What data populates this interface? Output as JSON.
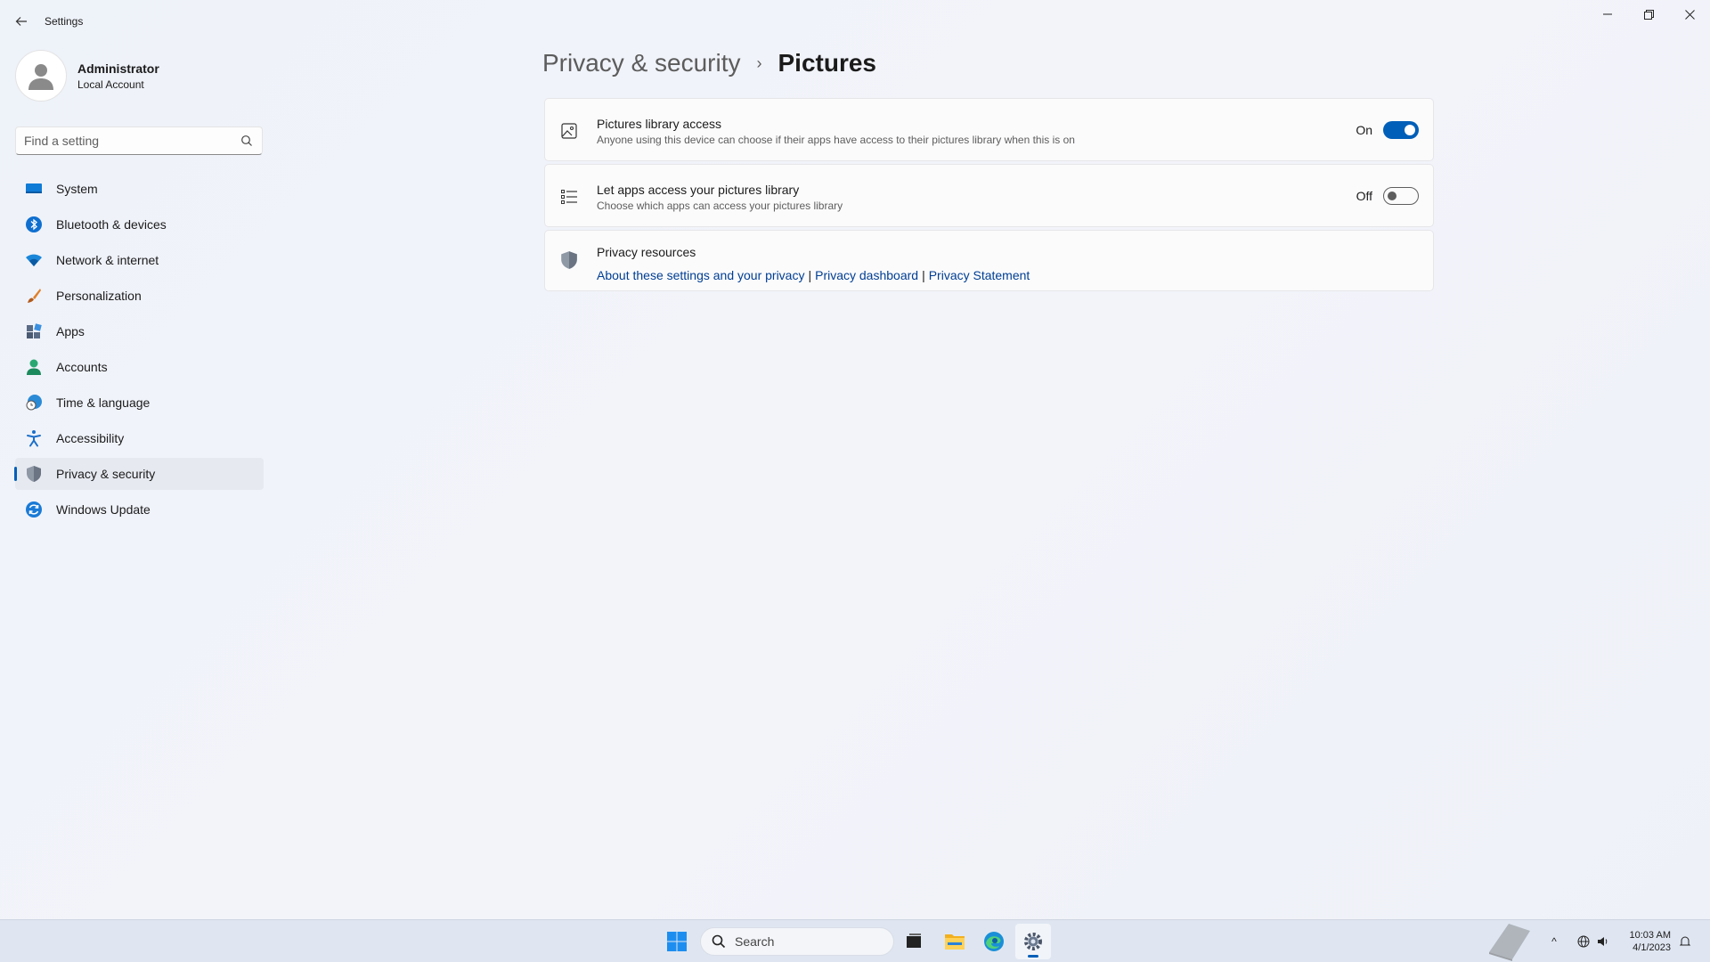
{
  "window": {
    "title": "Settings"
  },
  "profile": {
    "name": "Administrator",
    "account_type": "Local Account"
  },
  "search": {
    "placeholder": "Find a setting"
  },
  "sidebar": {
    "items": [
      {
        "label": "System",
        "icon": "system-icon",
        "active": false
      },
      {
        "label": "Bluetooth & devices",
        "icon": "bluetooth-icon",
        "active": false
      },
      {
        "label": "Network & internet",
        "icon": "wifi-icon",
        "active": false
      },
      {
        "label": "Personalization",
        "icon": "brush-icon",
        "active": false
      },
      {
        "label": "Apps",
        "icon": "apps-icon",
        "active": false
      },
      {
        "label": "Accounts",
        "icon": "person-icon",
        "active": false
      },
      {
        "label": "Time & language",
        "icon": "globe-clock-icon",
        "active": false
      },
      {
        "label": "Accessibility",
        "icon": "accessibility-icon",
        "active": false
      },
      {
        "label": "Privacy & security",
        "icon": "shield-icon",
        "active": true
      },
      {
        "label": "Windows Update",
        "icon": "update-icon",
        "active": false
      }
    ]
  },
  "breadcrumb": {
    "parent": "Privacy & security",
    "separator": "›",
    "current": "Pictures"
  },
  "settings": {
    "library_access": {
      "title": "Pictures library access",
      "description": "Anyone using this device can choose if their apps have access to their pictures library when this is on",
      "state_label": "On",
      "on": true
    },
    "apps_access": {
      "title": "Let apps access your pictures library",
      "description": "Choose which apps can access your pictures library",
      "state_label": "Off",
      "on": false
    }
  },
  "resources": {
    "title": "Privacy resources",
    "links": [
      "About these settings and your privacy",
      "Privacy dashboard",
      "Privacy Statement"
    ],
    "separator": "|"
  },
  "taskbar": {
    "search_label": "Search",
    "time": "10:03 AM",
    "date": "4/1/2023"
  },
  "colors": {
    "accent": "#005fb8",
    "link": "#003e92"
  }
}
